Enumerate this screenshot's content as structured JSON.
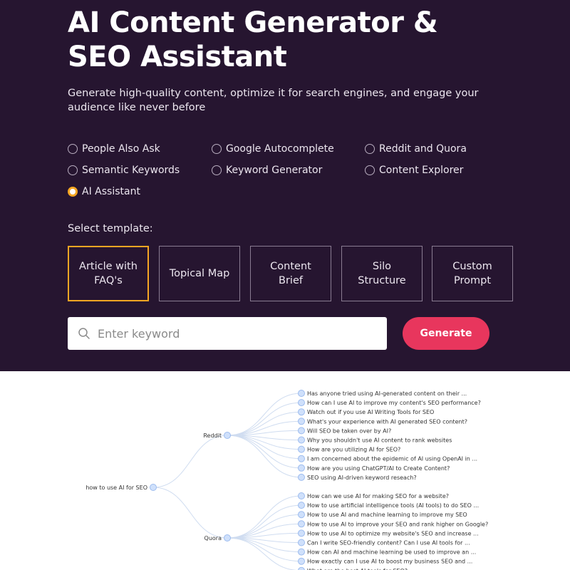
{
  "hero": {
    "title_line1": "AI Content Generator &",
    "title_line2": "SEO Assistant",
    "subtitle_line1": "Generate high-quality content, optimize it for search engines, and engage your",
    "subtitle_line2": "audience like never before"
  },
  "tools": [
    {
      "label": "People Also Ask",
      "checked": false
    },
    {
      "label": "Google Autocomplete",
      "checked": false
    },
    {
      "label": "Reddit and Quora",
      "checked": false
    },
    {
      "label": "Semantic Keywords",
      "checked": false
    },
    {
      "label": "Keyword Generator",
      "checked": false
    },
    {
      "label": "Content Explorer",
      "checked": false
    },
    {
      "label": "AI Assistant",
      "checked": true
    }
  ],
  "templates": {
    "label": "Select template:",
    "items": [
      {
        "line1": "Article with",
        "line2": "FAQ's",
        "active": true
      },
      {
        "line1": "Topical Map",
        "line2": "",
        "active": false
      },
      {
        "line1": "Content",
        "line2": "Brief",
        "active": false
      },
      {
        "line1": "Silo",
        "line2": "Structure",
        "active": false
      },
      {
        "line1": "Custom",
        "line2": "Prompt",
        "active": false
      }
    ]
  },
  "search": {
    "placeholder": "Enter keyword",
    "button_label": "Generate"
  },
  "colors": {
    "hero_bg": "#261530",
    "accent": "#f5a623",
    "button": "#e8365d",
    "node_fill": "#cfe0fb",
    "node_stroke": "#9dbcef"
  },
  "mindmap": {
    "root": "how to use AI for SEO",
    "branches": [
      {
        "label": "Reddit",
        "items": [
          "Has anyone tried using AI-generated content on their ...",
          "How can I use AI to improve my content's SEO performance?",
          "Watch out if you use AI Writing Tools for SEO",
          "What's your experience with AI generated SEO content?",
          "Will SEO be taken over by AI?",
          "Why you shouldn't use AI content to rank websites",
          "How are you utilizing AI for SEO?",
          "I am concerned about the epidemic of AI using OpenAI in ...",
          "How are you using ChatGPT/AI to Create Content?",
          "SEO using AI-driven keyword reseach?"
        ]
      },
      {
        "label": "Quora",
        "items": [
          "How can we use AI for making SEO for a website?",
          "How to use artificial intelligence tools (AI tools) to do SEO ...",
          "How to use AI and machine learning to improve my SEO",
          "How to use AI to improve your SEO and rank higher on Google?",
          "How to use AI to optimize my website's SEO and increase ...",
          "Can I write SEO-friendly content? Can I use AI tools for ...",
          "How can AI and machine learning be used to improve an ...",
          "How exactly can I use AI to boost my business SEO and ...",
          "What are the best AI tools for SEO?"
        ]
      }
    ]
  }
}
